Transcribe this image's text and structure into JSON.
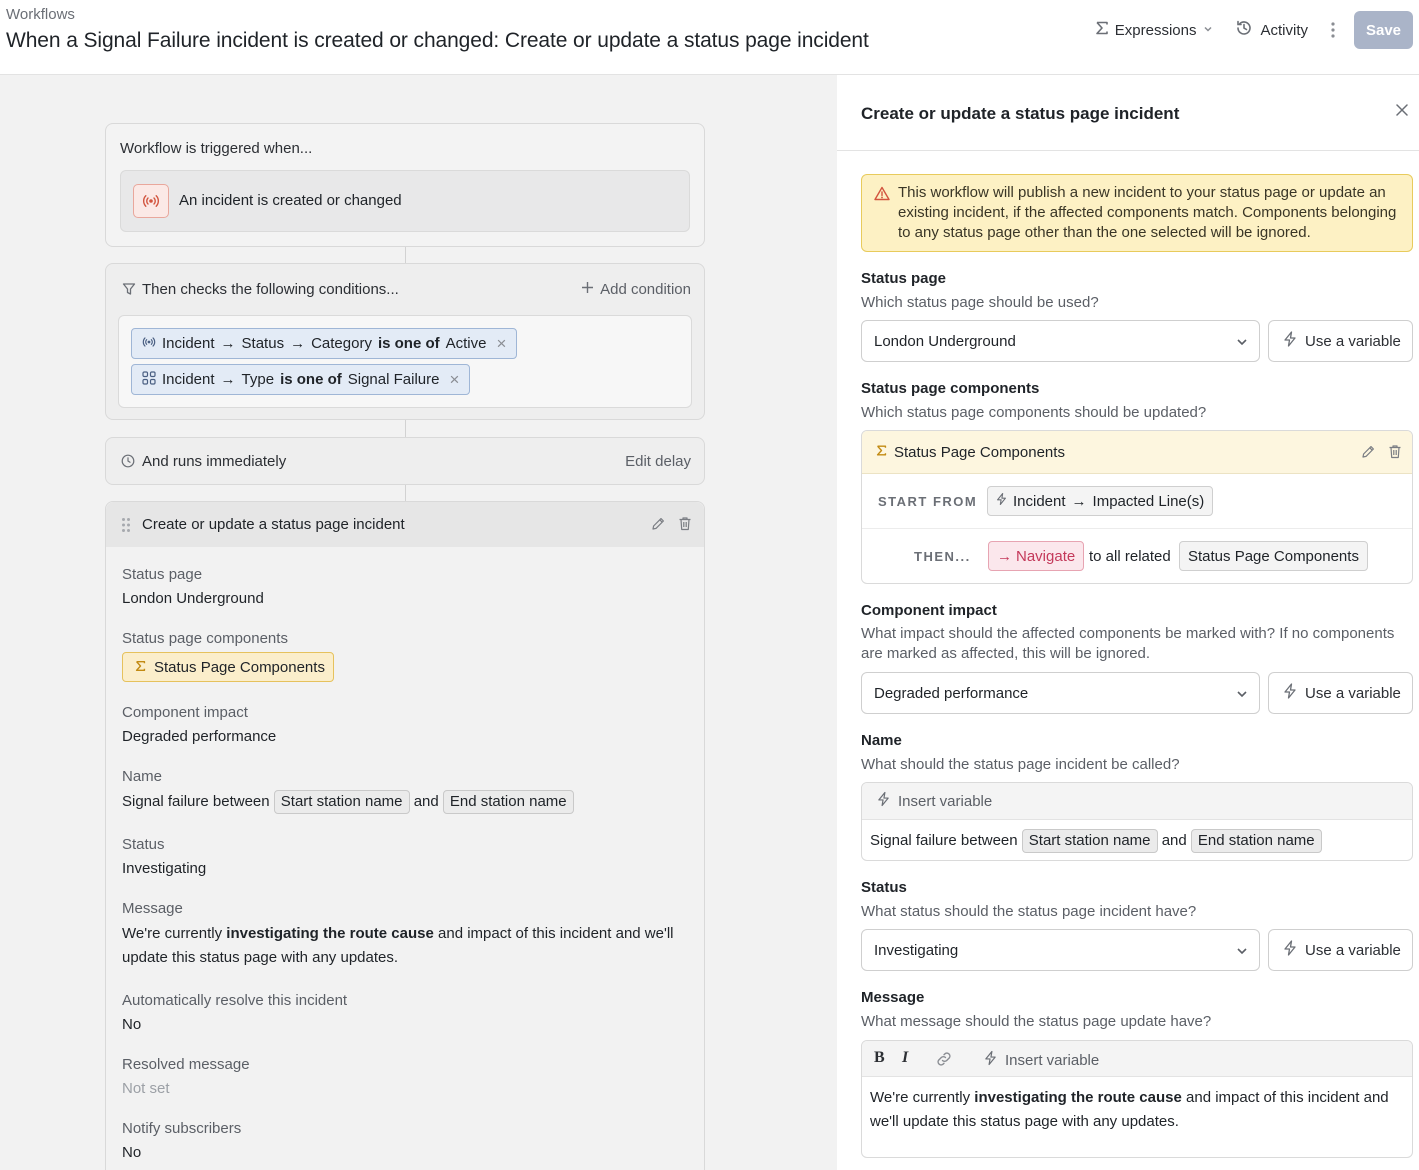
{
  "header": {
    "breadcrumb": "Workflows",
    "title": "When a Signal Failure incident is created or changed: Create or update a status page incident",
    "expressions_label": "Expressions",
    "activity_label": "Activity",
    "save_label": "Save"
  },
  "canvas": {
    "trigger": {
      "label": "Workflow is triggered when...",
      "event": "An incident is created or changed"
    },
    "conditions": {
      "label": "Then checks the following conditions...",
      "add_label": "Add condition",
      "items": [
        {
          "path_a": "Incident",
          "path_b": "Status",
          "path_c": "Category",
          "op": "is one of",
          "value": "Active"
        },
        {
          "path_a": "Incident",
          "path_b": "Type",
          "op": "is one of",
          "value": "Signal Failure"
        }
      ]
    },
    "delay": {
      "label": "And runs immediately",
      "edit_label": "Edit delay"
    },
    "action": {
      "title": "Create or update a status page incident",
      "fields": {
        "status_page_label": "Status page",
        "status_page_value": "London Underground",
        "components_label": "Status page components",
        "components_value": "Status Page Components",
        "impact_label": "Component impact",
        "impact_value": "Degraded performance",
        "name_label": "Name",
        "name_prefix": "Signal failure between",
        "name_var1": "Start station name",
        "name_and": "and",
        "name_var2": "End station name",
        "status_label": "Status",
        "status_value": "Investigating",
        "message_label": "Message",
        "message_pre": "We're currently ",
        "message_bold": "investigating the route cause",
        "message_post": " and impact of this incident and we'll update this status page with any updates.",
        "auto_resolve_label": "Automatically resolve this incident",
        "auto_resolve_value": "No",
        "resolved_msg_label": "Resolved message",
        "resolved_msg_value": "Not set",
        "notify_label": "Notify subscribers",
        "notify_value": "No"
      }
    }
  },
  "panel": {
    "title": "Create or update a status page incident",
    "warning": "This workflow will publish a new incident to your status page or update an existing incident, if the affected components match. Components belonging to any status page other than the one selected will be ignored.",
    "use_variable_label": "Use a variable",
    "status_page": {
      "label": "Status page",
      "help": "Which status page should be used?",
      "value": "London Underground"
    },
    "components": {
      "label": "Status page components",
      "help": "Which status page components should be updated?",
      "expr_title": "Status Page Components",
      "start_from_key": "START FROM",
      "start_from_a": "Incident",
      "start_from_b": "Impacted Line(s)",
      "then_key": "THEN...",
      "navigate_label": "Navigate",
      "to_all_related": "to all related",
      "target": "Status Page Components"
    },
    "impact": {
      "label": "Component impact",
      "help": "What impact should the affected components be marked with? If no components are marked as affected, this will be ignored.",
      "value": "Degraded performance"
    },
    "name": {
      "label": "Name",
      "help": "What should the status page incident be called?",
      "insert_variable": "Insert variable",
      "prefix": "Signal failure between",
      "var1": "Start station name",
      "and": "and",
      "var2": "End station name"
    },
    "status": {
      "label": "Status",
      "help": "What status should the status page incident have?",
      "value": "Investigating"
    },
    "message": {
      "label": "Message",
      "help": "What message should the status page update have?",
      "bold_btn": "B",
      "italic_btn": "I",
      "insert_variable": "Insert variable",
      "pre": "We're currently ",
      "bold": "investigating the route cause",
      "post": " and impact of this incident and we'll update this status page with any updates."
    }
  },
  "colors": {
    "save_disabled": "#aab4c8",
    "warning_bg": "#fdf1c4",
    "expression_yellow": "#fbeecb",
    "condition_chip": "#e3ebf6",
    "navigate_pink": "#c4395a"
  },
  "icons": [
    "sigma-icon",
    "chevron-down-icon",
    "history-icon",
    "kebab-icon",
    "broadcast-icon",
    "filter-icon",
    "plus-icon",
    "close-icon",
    "grid-icon",
    "clock-icon",
    "drag-handle-icon",
    "pencil-icon",
    "trash-icon",
    "warning-icon",
    "bolt-icon",
    "link-icon"
  ]
}
